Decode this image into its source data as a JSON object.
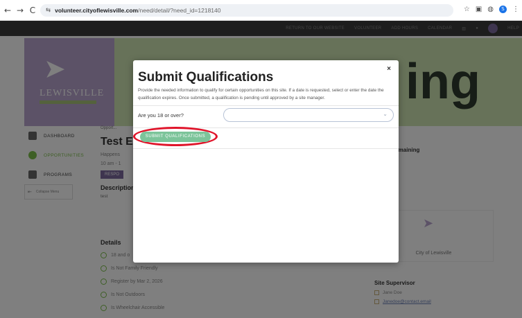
{
  "browser": {
    "back": "←",
    "forward": "→",
    "reload": "C",
    "site_info": "⇆",
    "url_host": "volunteer.cityoflewisville.com",
    "url_path": "/need/detail/?need_id=1218140",
    "profile_letter": "S"
  },
  "site_nav": {
    "items": [
      "RETURN TO OUR WEBSITE",
      "VOLUNTEER",
      "ADD HOURS",
      "CALENDAR",
      "HELP"
    ]
  },
  "logo": {
    "name": "LEWISVILLE"
  },
  "banner": {
    "word": "ing"
  },
  "sidebar": {
    "items": [
      {
        "label": "DASHBOARD"
      },
      {
        "label": "OPPORTUNITIES"
      },
      {
        "label": "PROGRAMS"
      }
    ],
    "collapse_label": "Collapse Menu"
  },
  "background": {
    "crumb": "Opport...",
    "title": "Test E",
    "happens": "Happens",
    "time": "10 am - 1",
    "respond": "RESPO",
    "description_h": "Description",
    "description": "test",
    "details_h": "Details",
    "details": [
      "18 and o",
      "Is Not Family Friendly",
      "Register by Mar 2, 2026",
      "Is Not Outdoors",
      "Is Wheelchair Accessible"
    ],
    "spots": "Spots Remaining",
    "org_name": "City of Lewisville",
    "supervisor_h": "Site Supervisor",
    "supervisor_name": "Jane Doe",
    "supervisor_email": "Janedoe@contact.email"
  },
  "modal": {
    "title": "Submit Qualifications",
    "close": "×",
    "description": "Provide the needed information to qualify for certain opportunities on this site. If a date is requested, select or enter the date the qualification expires. Once submitted, a qualification is pending until approved by a site manager.",
    "question": "Are you 18 or over?",
    "select_value": "",
    "submit_label": "SUBMIT QUALIFICATIONS"
  },
  "colors": {
    "accent_green": "#7cc49a",
    "highlight_ring": "#e0152b",
    "brand_purple": "#b9a5cf"
  }
}
